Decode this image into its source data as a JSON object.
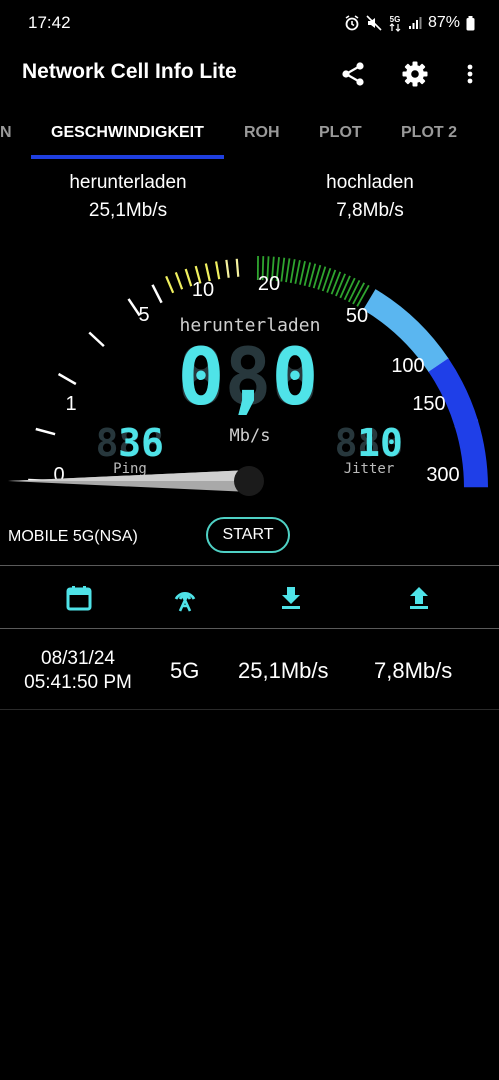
{
  "status_bar": {
    "time": "17:42",
    "battery": "87%",
    "icons": [
      "alarm-icon",
      "mute-icon",
      "5g-icon",
      "signal-icon",
      "battery-icon"
    ]
  },
  "app_bar": {
    "title": "Network Cell Info Lite",
    "actions": [
      "share-icon",
      "settings-icon",
      "more-icon"
    ]
  },
  "tabs": [
    {
      "label": "N",
      "active": false
    },
    {
      "label": "GESCHWINDIGKEIT",
      "active": true
    },
    {
      "label": "ROH",
      "active": false
    },
    {
      "label": "PLOT",
      "active": false
    },
    {
      "label": "PLOT 2",
      "active": false
    }
  ],
  "speeds": {
    "download_label": "herunterladen",
    "download_value": "25,1Mb/s",
    "upload_label": "hochladen",
    "upload_value": "7,8Mb/s"
  },
  "gauge": {
    "mode_label": "herunterladen",
    "reading": "0,0",
    "unit": "Mb/s",
    "scale_labels": [
      "0",
      "1",
      "5",
      "10",
      "20",
      "50",
      "100",
      "150",
      "300"
    ],
    "ping_value": "36",
    "ping_label": "Ping",
    "jitter_value": "10",
    "jitter_label": "Jitter",
    "colors": {
      "white": "#ffffff",
      "yellow": "#f0f060",
      "green": "#2fa52f",
      "light_blue": "#5ab6f0",
      "blue": "#1f3fe8",
      "digits": "#4fe3e8"
    }
  },
  "controls": {
    "network_type": "MOBILE 5G(NSA)",
    "start_label": "START"
  },
  "history": {
    "header_icons": [
      "calendar-icon",
      "antenna-icon",
      "download-icon",
      "upload-icon"
    ],
    "rows": [
      {
        "date": "08/31/24",
        "time": "05:41:50 PM",
        "network": "5G",
        "download": "25,1Mb/s",
        "upload": "7,8Mb/s"
      }
    ]
  }
}
